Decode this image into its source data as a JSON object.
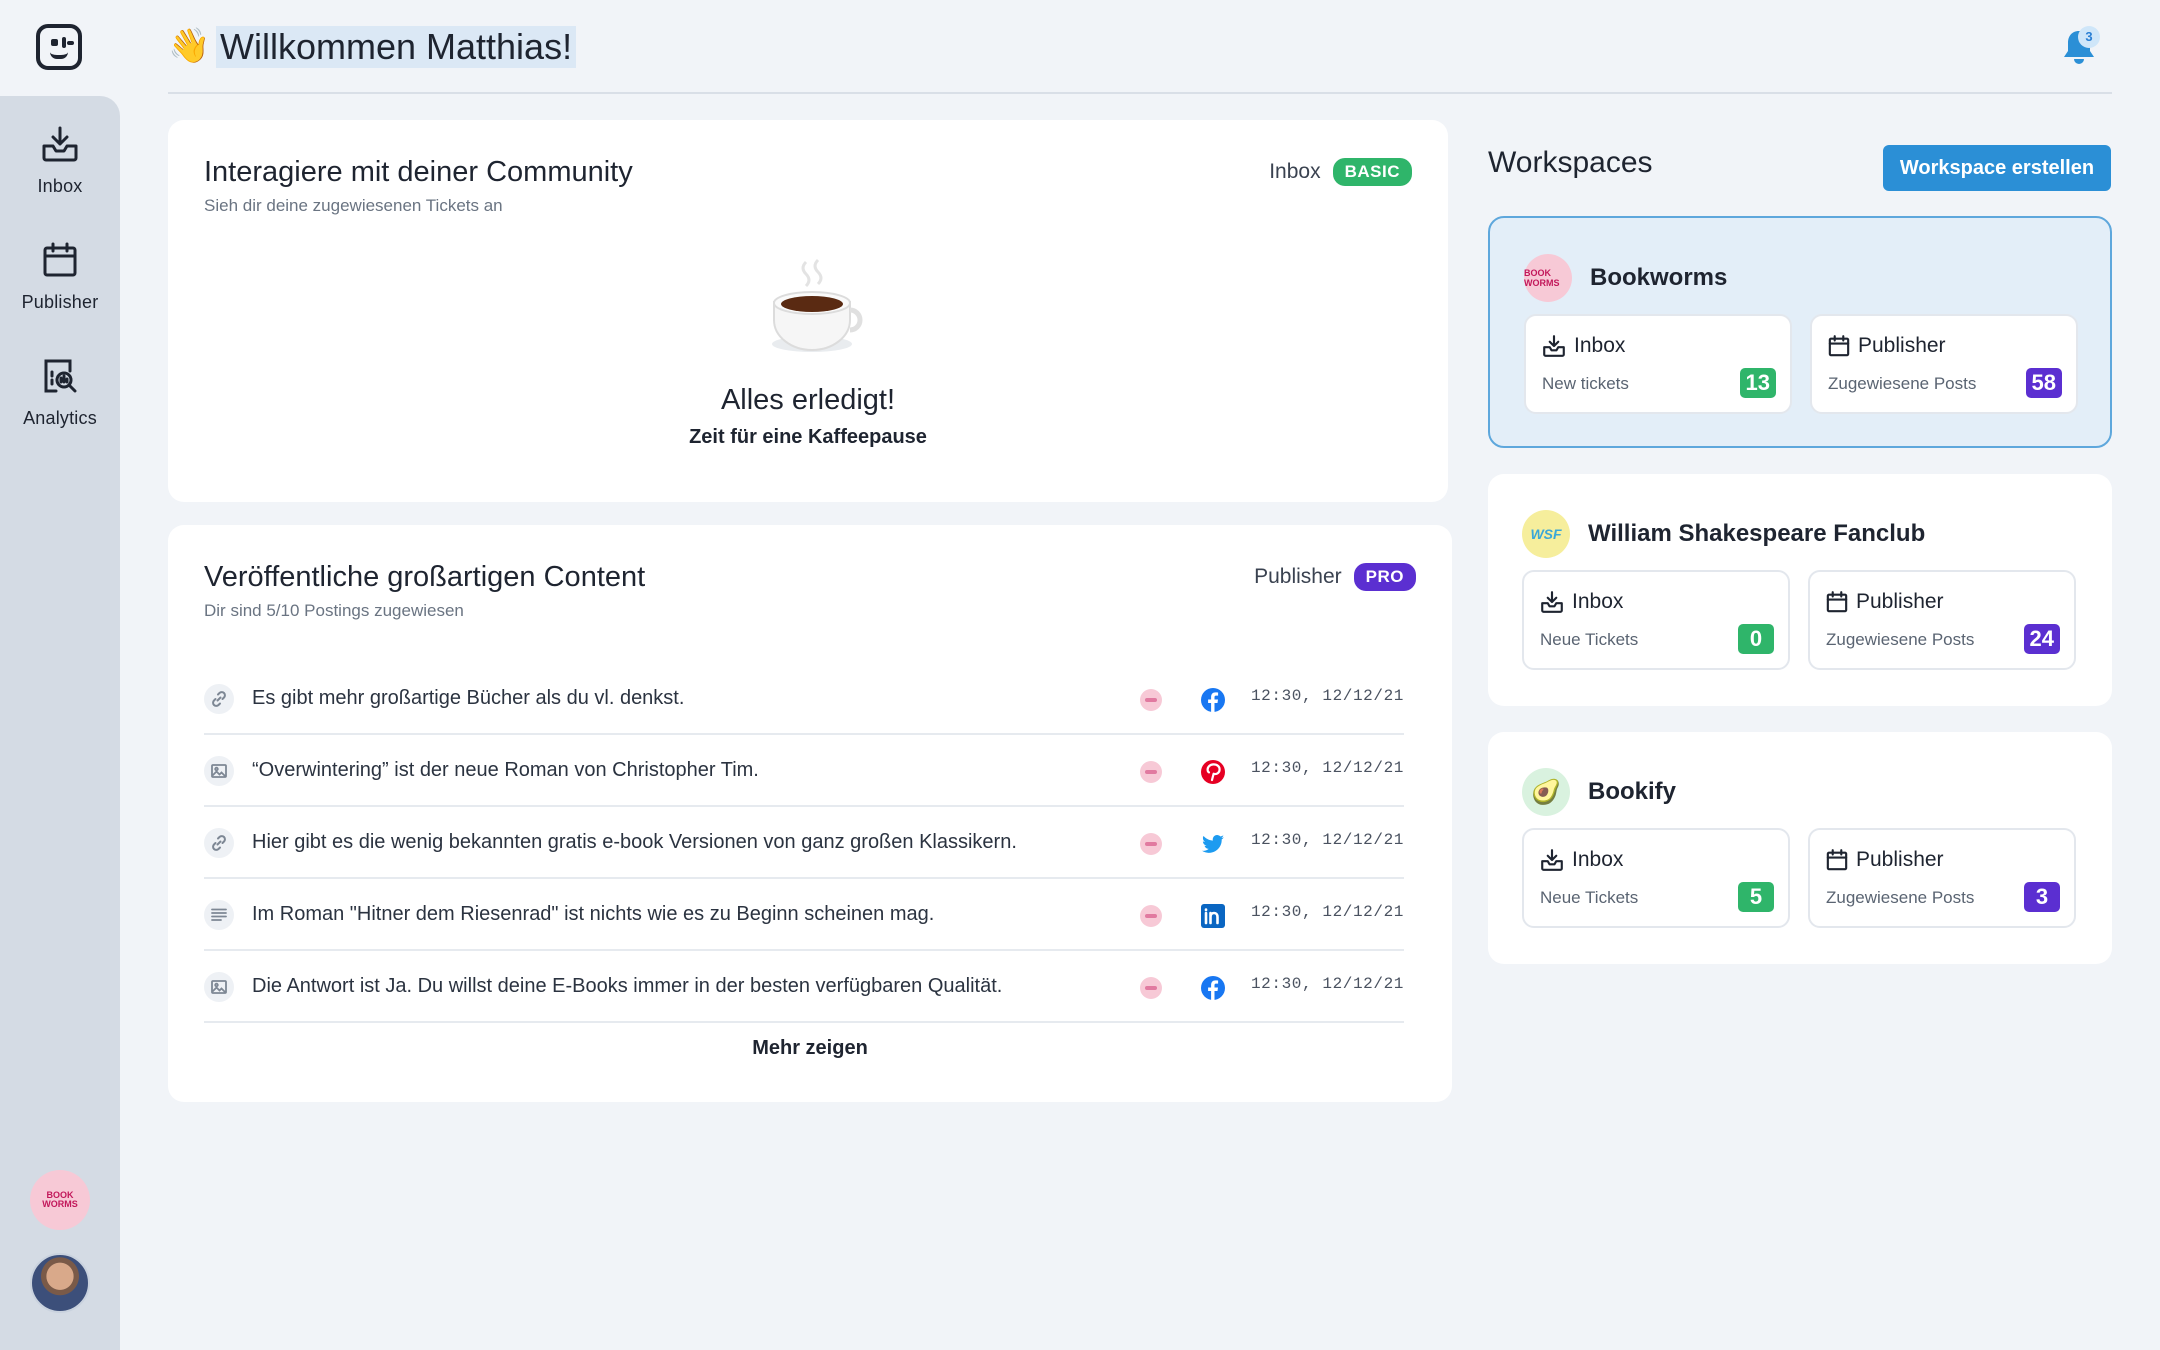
{
  "sidebar": {
    "items": [
      {
        "label": "Inbox",
        "icon": "inbox-icon"
      },
      {
        "label": "Publisher",
        "icon": "calendar-icon"
      },
      {
        "label": "Analytics",
        "icon": "analytics-icon"
      }
    ],
    "workspace_avatar_text": "BOOK WORMS"
  },
  "header": {
    "greeting_emoji": "👋",
    "title": "Willkommen Matthias!",
    "notification_count": "3"
  },
  "community_card": {
    "title": "Interagiere mit deiner Community",
    "subtitle": "Sieh dir deine zugewiesenen Tickets an",
    "tag_label": "Inbox",
    "badge": "BASIC",
    "empty_title": "Alles erledigt!",
    "empty_subtitle": "Zeit für eine Kaffeepause"
  },
  "publisher_card": {
    "title": "Veröffentliche großartigen Content",
    "subtitle": "Dir sind 5/10 Postings zugewiesen",
    "tag_label": "Publisher",
    "badge": "PRO",
    "more_label": "Mehr zeigen",
    "posts": [
      {
        "type": "link",
        "text": "Es gibt mehr großartige Bücher als du vl. denkst.",
        "network": "facebook",
        "time": "12:30, 12/12/21"
      },
      {
        "type": "image",
        "text": "“Overwintering” ist der neue Roman von Christopher Tim.",
        "network": "pinterest",
        "time": "12:30, 12/12/21"
      },
      {
        "type": "link",
        "text": "Hier gibt es die wenig bekannten gratis e-book Versionen von ganz großen Klassikern.",
        "network": "twitter",
        "time": "12:30, 12/12/21"
      },
      {
        "type": "text",
        "text": "Im Roman \"Hitner dem Riesenrad\" ist nichts wie es zu Beginn scheinen mag.",
        "network": "linkedin",
        "time": "12:30, 12/12/21"
      },
      {
        "type": "image",
        "text": "Die Antwort ist Ja. Du willst deine E-Books immer in der besten verfügbaren Qualität.",
        "network": "facebook",
        "time": "12:30, 12/12/21"
      }
    ]
  },
  "workspaces": {
    "heading": "Workspaces",
    "create_label": "Workspace erstellen",
    "items": [
      {
        "name": "Bookworms",
        "logo_text": "BOOK WORMS",
        "inbox_label": "Inbox",
        "inbox_sub": "New tickets",
        "inbox_count": "13",
        "publisher_label": "Publisher",
        "publisher_sub": "Zugewiesene Posts",
        "publisher_count": "58",
        "active": true
      },
      {
        "name": "William Shakespeare Fanclub",
        "logo_text": "WSF",
        "inbox_label": "Inbox",
        "inbox_sub": "Neue Tickets",
        "inbox_count": "0",
        "publisher_label": "Publisher",
        "publisher_sub": "Zugewiesene Posts",
        "publisher_count": "24",
        "active": false
      },
      {
        "name": "Bookify",
        "logo_text": "🥑",
        "inbox_label": "Inbox",
        "inbox_sub": "Neue Tickets",
        "inbox_count": "5",
        "publisher_label": "Publisher",
        "publisher_sub": "Zugewiesene Posts",
        "publisher_count": "3",
        "active": false
      }
    ]
  },
  "colors": {
    "accent": "#2b8fd6",
    "success": "#2fb56a",
    "pro": "#5b2fd1",
    "sidebar": "#d4dbe4",
    "background": "#f1f4f8"
  }
}
